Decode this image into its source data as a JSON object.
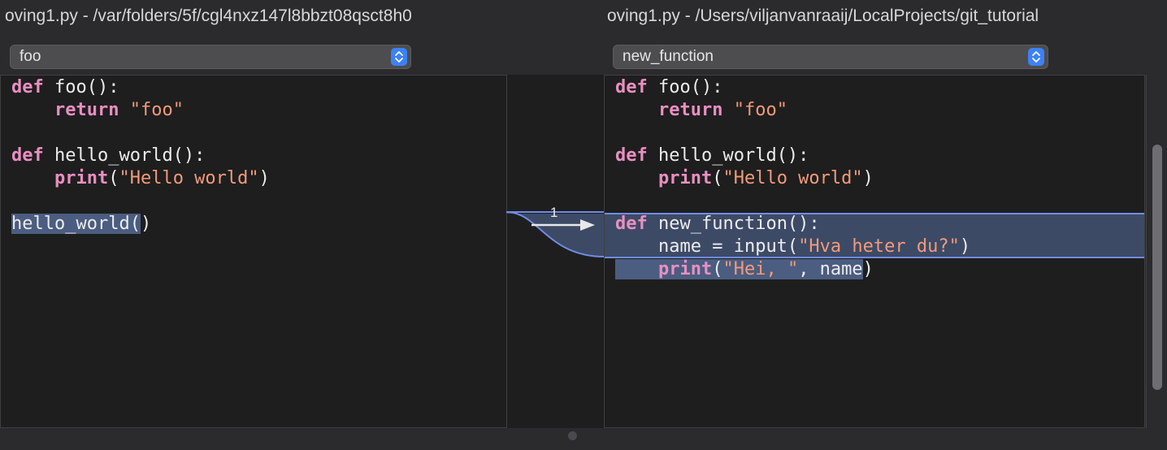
{
  "left": {
    "title": "oving1.py - /var/folders/5f/cgl4nxz147l8bbzt08qsct8h0",
    "function_popup": "foo",
    "code": {
      "l1_kw": "def",
      "l1_rest": " foo():",
      "l2_fn": "return",
      "l2_str": "\"foo\"",
      "l4_kw": "def",
      "l4_rest": " hello_world():",
      "l5_fn": "print",
      "l5_open": "(",
      "l5_str": "\"Hello world\"",
      "l5_close": ")",
      "l7_sel": "hello_world(",
      "l7_rest": ")"
    }
  },
  "right": {
    "title": "oving1.py - /Users/viljanvanraaij/LocalProjects/git_tutorial",
    "function_popup": "new_function",
    "code": {
      "l1_kw": "def",
      "l1_rest": " foo():",
      "l2_fn": "return",
      "l2_str": "\"foo\"",
      "l4_kw": "def",
      "l4_rest": " hello_world():",
      "l5_fn": "print",
      "l5_open": "(",
      "l5_str": "\"Hello world\"",
      "l5_close": ")",
      "l7_kw": "def",
      "l7_rest": " new_function():",
      "l8_a": "name",
      "l8_b": " = input(",
      "l8_str": "\"Hva heter du?\"",
      "l8_c": ")",
      "l9_fn": "print",
      "l9_open": "(",
      "l9_str": "\"Hei, \"",
      "l9_mid": ", name",
      "l9_close": ")"
    }
  },
  "merge": {
    "change_number": "1",
    "direction": "right-arrow"
  },
  "colors": {
    "keyword": "#e98fc1",
    "string": "#f29a7a",
    "change_highlight": "#3d4a66",
    "change_border": "#6f8ce8",
    "selection": "#4b5d80"
  }
}
